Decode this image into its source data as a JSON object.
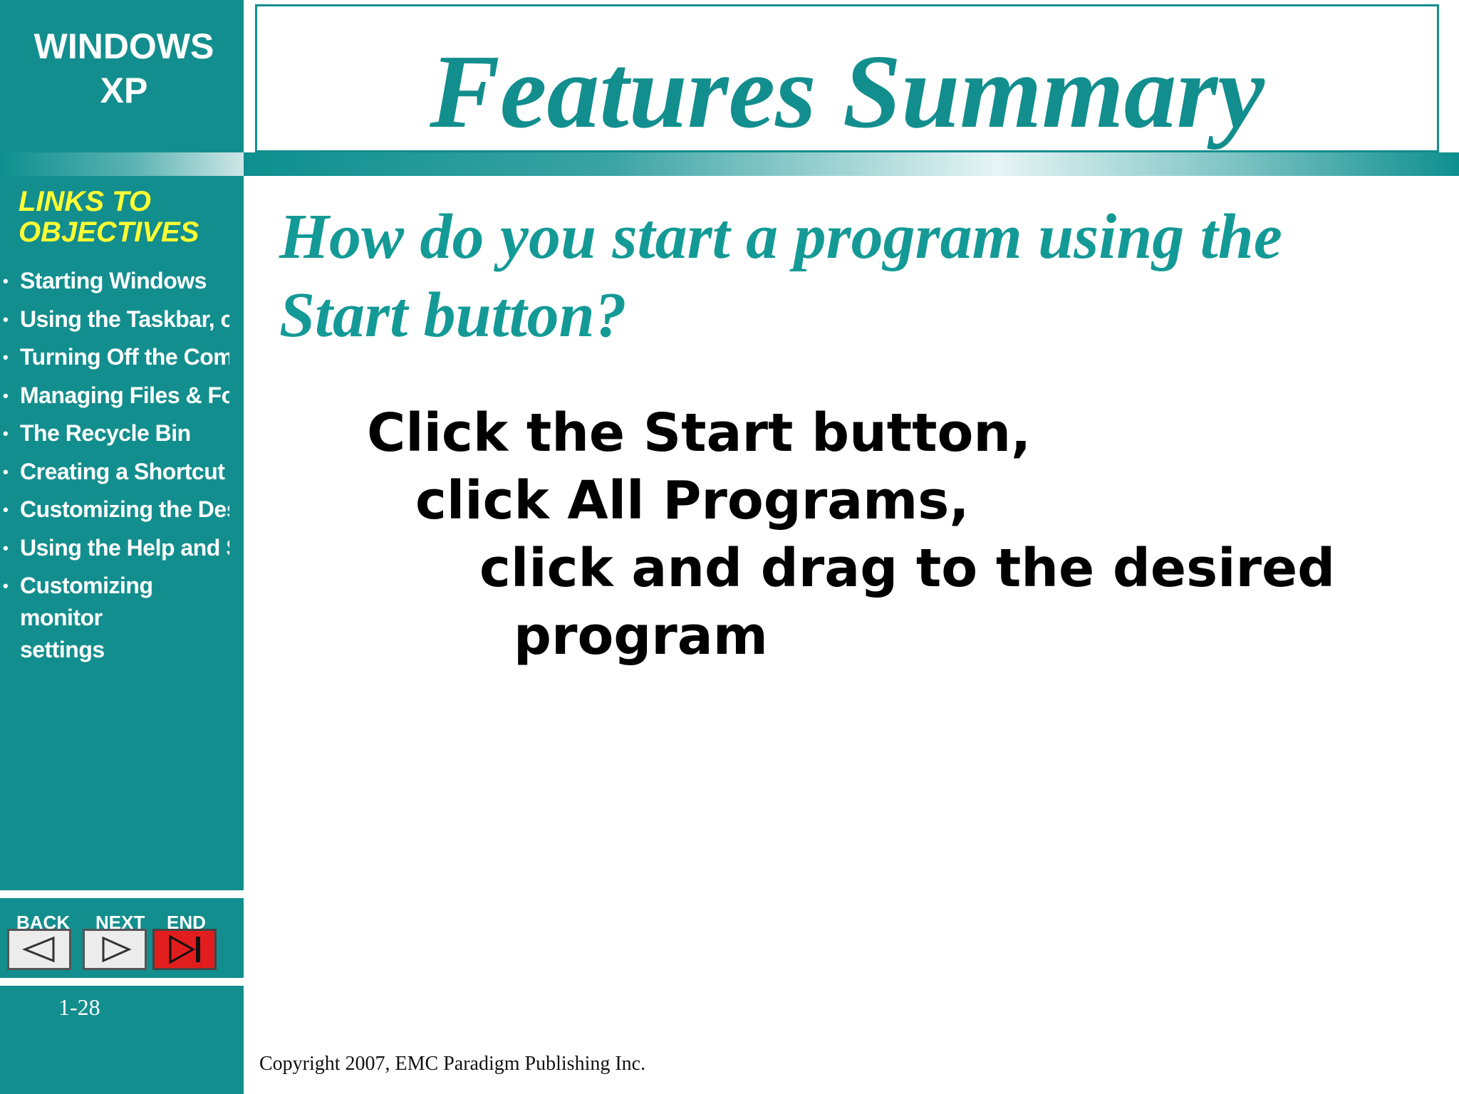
{
  "sidebar": {
    "brand_line1": "WINDOWS",
    "brand_line2": "XP",
    "objectives_heading_line1": "LINKS TO",
    "objectives_heading_line2": "OBJECTIVES",
    "objectives": [
      "Starting Windows",
      "Using the Taskbar, op",
      "Turning Off the Comp",
      "Managing Files & Fol",
      "The Recycle Bin",
      "Creating a Shortcut",
      "Customizing the Des",
      "Using the Help and S",
      "Customizing monitor settings"
    ],
    "nav": {
      "back_label": "BACK",
      "next_label": "NEXT",
      "end_label": "END",
      "back_icon": "triangle-left-icon",
      "next_icon": "triangle-right-icon",
      "end_icon": "skip-to-end-icon"
    },
    "page_number": "1-28"
  },
  "title": "Features Summary",
  "question": "How do you start a program using the Start button?",
  "answer": {
    "line1": "Click the Start button,",
    "line2": "click All Programs,",
    "line3": "click and drag to the desired",
    "line4": "program"
  },
  "copyright": "Copyright 2007, EMC Paradigm Publishing Inc.",
  "colors": {
    "teal": "#138e8e",
    "heading_yellow": "#ffff33",
    "end_red": "#e21d1d"
  }
}
